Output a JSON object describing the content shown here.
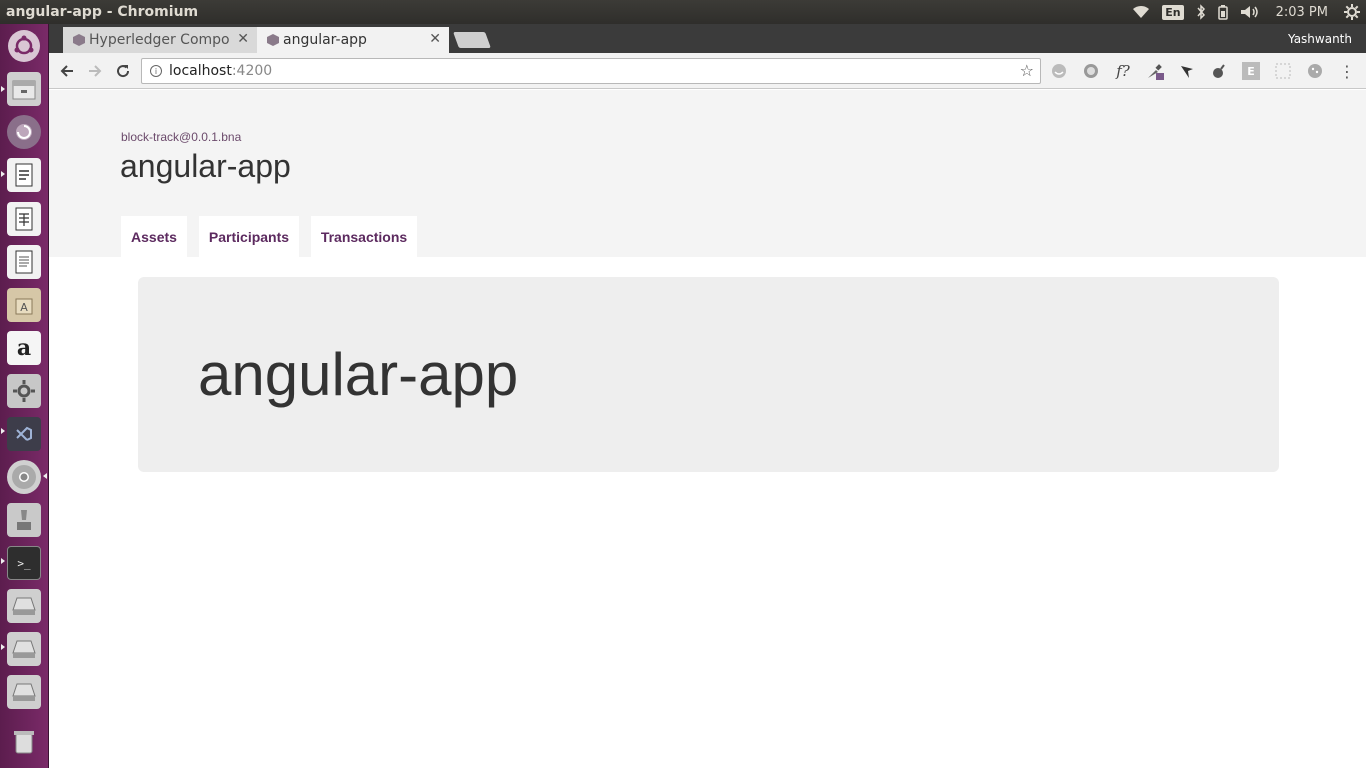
{
  "os": {
    "window_title": "angular-app - Chromium",
    "tray": {
      "language": "En",
      "clock": "2:03 PM"
    },
    "launcher_icons": [
      "ubuntu-dash-icon",
      "files-icon",
      "backups-icon",
      "writer-icon",
      "calc-icon",
      "text-editor-icon",
      "software-center-icon",
      "amazon-icon",
      "system-settings-icon",
      "vscode-icon",
      "chromium-icon",
      "install-icon",
      "terminal-icon",
      "drive-icon",
      "drive-icon",
      "drive-icon",
      "trash-icon"
    ]
  },
  "browser": {
    "tabs": [
      {
        "title": "Hyperledger Compo",
        "active": false
      },
      {
        "title": "angular-app",
        "active": true
      }
    ],
    "profile_name": "Yashwanth",
    "url_host": "localhost",
    "url_port": ":4200"
  },
  "page": {
    "network_name": "block-track@0.0.1.bna",
    "app_title": "angular-app",
    "nav_tabs": [
      "Assets",
      "Participants",
      "Transactions"
    ],
    "jumbotron_title": "angular-app"
  },
  "colors": {
    "launcher": "#7a2a68",
    "nav_text": "#5c2a5f",
    "header_bg": "#f4f4f4",
    "jumbotron_bg": "#eeeeee"
  }
}
